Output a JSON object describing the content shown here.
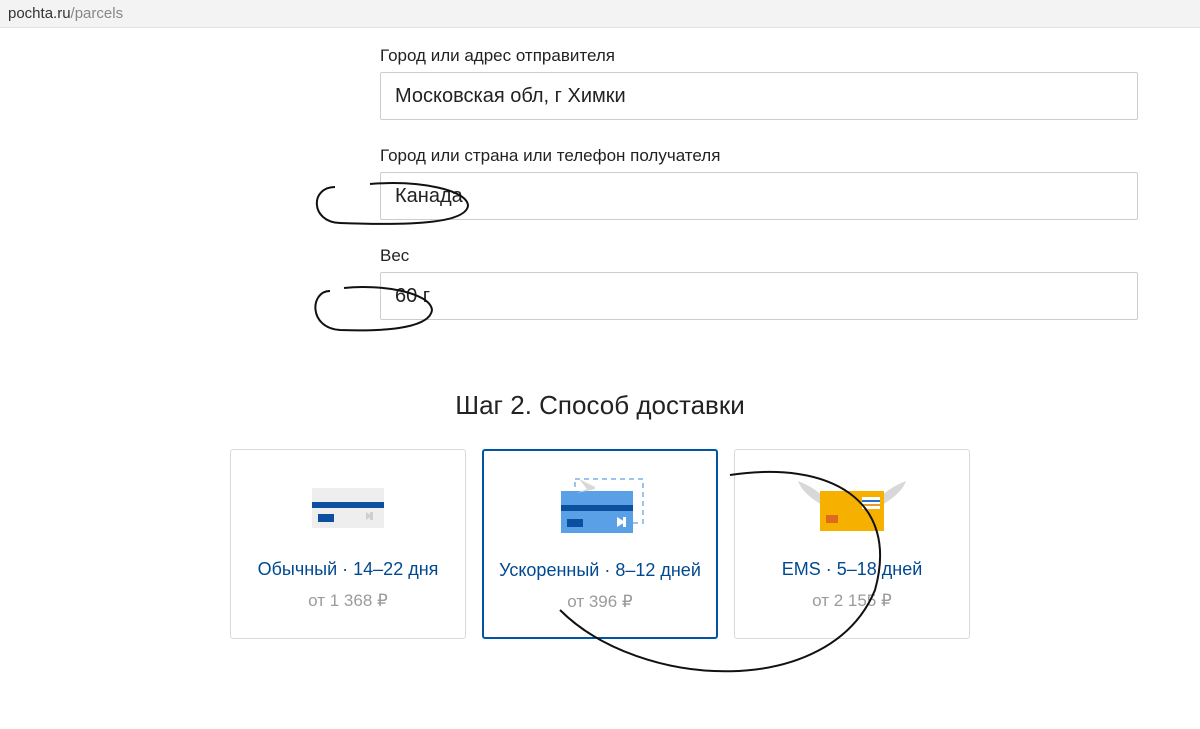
{
  "browser": {
    "url_host": "pochta.ru",
    "url_path": "/parcels"
  },
  "form": {
    "sender_label": "Город или адрес отправителя",
    "sender_value": "Московская обл, г Химки",
    "recipient_label": "Город или страна или телефон получателя",
    "recipient_value": "Канада",
    "weight_label": "Вес",
    "weight_value": "60 г"
  },
  "step2": {
    "title": "Шаг 2. Способ доставки",
    "options": [
      {
        "title": "Обычный · 14–22 дня",
        "price": "от 1 368 ₽",
        "selected": false
      },
      {
        "title": "Ускоренный · 8–12 дней",
        "price": "от 396 ₽",
        "selected": true
      },
      {
        "title": "EMS · 5–18 дней",
        "price": "от 2 155 ₽",
        "selected": false
      }
    ]
  }
}
